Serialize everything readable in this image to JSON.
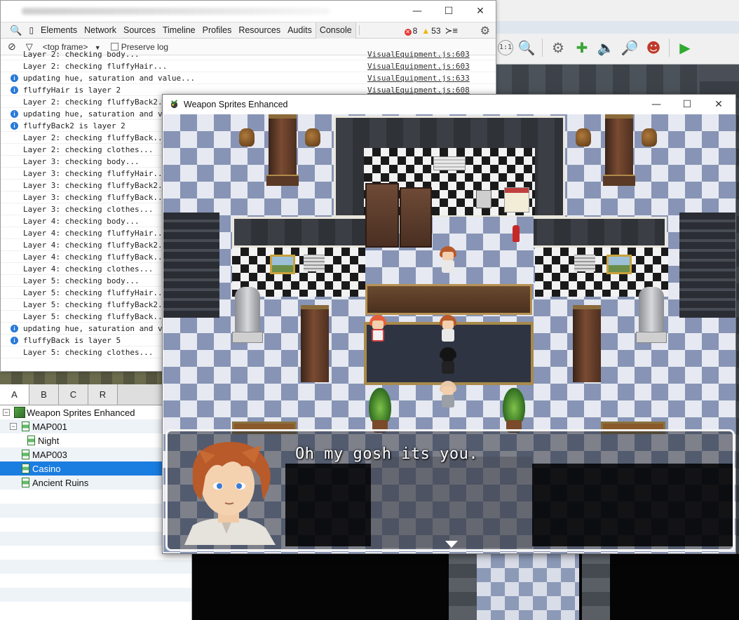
{
  "editor": {
    "palette_tabs": [
      "A",
      "B",
      "C",
      "R"
    ],
    "active_palette_tab": "A",
    "map_tree": [
      {
        "label": "Weapon Sprites Enhanced",
        "level": 0,
        "expander": "minus",
        "icon": "project-icon"
      },
      {
        "label": "MAP001",
        "level": 1,
        "expander": "minus",
        "icon": "map-icon"
      },
      {
        "label": "Night",
        "level": 2,
        "expander": "",
        "icon": "map-icon"
      },
      {
        "label": "MAP003",
        "level": 1,
        "expander": "",
        "icon": "map-icon"
      },
      {
        "label": "Casino",
        "level": 1,
        "expander": "",
        "icon": "map-icon",
        "selected": true
      },
      {
        "label": "Ancient Ruins",
        "level": 1,
        "expander": "",
        "icon": "map-icon"
      }
    ],
    "toolbar_icons": [
      "zoom-1-1-icon",
      "zoom-icon",
      "database-gear-icon",
      "plugin-puzzle-icon",
      "sound-icon",
      "resource-manager-icon",
      "character-generator-icon",
      "playtest-icon"
    ]
  },
  "devtools": {
    "tabs": [
      "Elements",
      "Network",
      "Sources",
      "Timeline",
      "Profiles",
      "Resources",
      "Audits",
      "Console"
    ],
    "active_tab": "Console",
    "error_count": "8",
    "warning_count": "53",
    "frame_selector": "<top frame>",
    "preserve_log_label": "Preserve log",
    "window_controls": {
      "minimize": "—",
      "maximize": "☐",
      "close": "✕"
    },
    "logs": [
      {
        "msg": "Layer 2: checking body...",
        "src": "VisualEquipment.js:603",
        "info": false
      },
      {
        "msg": "Layer 2: checking fluffyHair...",
        "src": "VisualEquipment.js:603",
        "info": false
      },
      {
        "msg": "updating hue, saturation and value...",
        "src": "VisualEquipment.js:633",
        "info": true
      },
      {
        "msg": "fluffyHair is layer 2",
        "src": "VisualEquipment.js:608",
        "info": true
      },
      {
        "msg": "Layer 2: checking fluffyBack2...",
        "src": "",
        "info": false
      },
      {
        "msg": "updating hue, saturation and v",
        "src": "",
        "info": true
      },
      {
        "msg": "fluffyBack2 is layer 2",
        "src": "",
        "info": true
      },
      {
        "msg": "Layer 2: checking fluffyBack...",
        "src": "",
        "info": false
      },
      {
        "msg": "Layer 2: checking clothes...",
        "src": "",
        "info": false
      },
      {
        "msg": "Layer 3: checking body...",
        "src": "",
        "info": false
      },
      {
        "msg": "Layer 3: checking fluffyHair...",
        "src": "",
        "info": false
      },
      {
        "msg": "Layer 3: checking fluffyBack2...",
        "src": "",
        "info": false
      },
      {
        "msg": "Layer 3: checking fluffyBack...",
        "src": "",
        "info": false
      },
      {
        "msg": "Layer 3: checking clothes...",
        "src": "",
        "info": false
      },
      {
        "msg": "Layer 4: checking body...",
        "src": "",
        "info": false
      },
      {
        "msg": "Layer 4: checking fluffyHair...",
        "src": "",
        "info": false
      },
      {
        "msg": "Layer 4: checking fluffyBack2...",
        "src": "",
        "info": false
      },
      {
        "msg": "Layer 4: checking fluffyBack...",
        "src": "",
        "info": false
      },
      {
        "msg": "Layer 4: checking clothes...",
        "src": "",
        "info": false
      },
      {
        "msg": "Layer 5: checking body...",
        "src": "",
        "info": false
      },
      {
        "msg": "Layer 5: checking fluffyHair...",
        "src": "",
        "info": false
      },
      {
        "msg": "Layer 5: checking fluffyBack2...",
        "src": "",
        "info": false
      },
      {
        "msg": "Layer 5: checking fluffyBack...",
        "src": "",
        "info": false
      },
      {
        "msg": "updating hue, saturation and v",
        "src": "",
        "info": true
      },
      {
        "msg": "fluffyBack is layer 5",
        "src": "",
        "info": true
      },
      {
        "msg": "Layer 5: checking clothes...",
        "src": "",
        "info": false
      }
    ],
    "prompt": ">"
  },
  "game_window": {
    "title": "Weapon Sprites Enhanced",
    "window_controls": {
      "minimize": "—",
      "maximize": "☐",
      "close": "✕"
    },
    "dialog_text": "Oh my gosh its you."
  },
  "colors": {
    "selection": "#1a7de0",
    "info_icon": "#2879d9",
    "error": "#e53935",
    "warning": "#f2b600"
  }
}
